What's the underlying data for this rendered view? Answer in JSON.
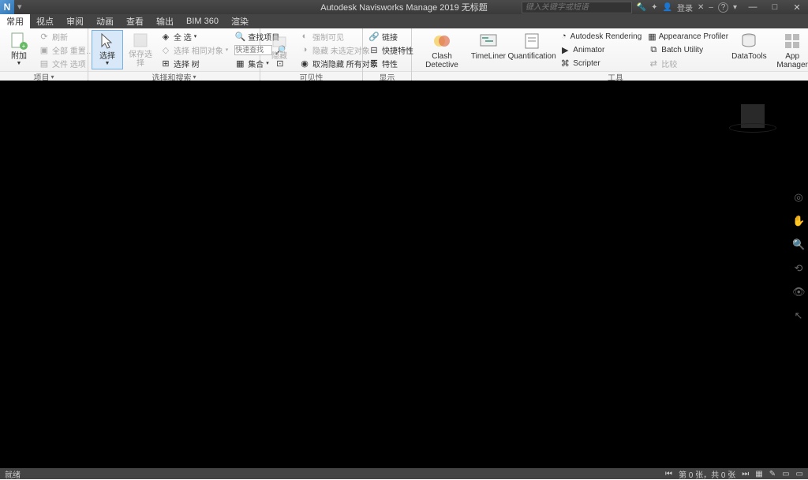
{
  "title": "Autodesk Navisworks Manage 2019    无标题",
  "search_placeholder": "键入关键字或短语",
  "login_label": "登录",
  "menus": [
    "常用",
    "视点",
    "审阅",
    "动画",
    "查看",
    "输出",
    "BIM 360",
    "渲染"
  ],
  "active_menu": 0,
  "panels": {
    "project": {
      "label": "项目",
      "append": "附加",
      "refresh": "刷新",
      "reset_all": "全部 重置…",
      "file_options": "文件 选项"
    },
    "select_search": {
      "label": "选择和搜索",
      "select": "选择",
      "save_sel": "保存选择",
      "select_all": "全 选",
      "sel_adjacent": "选择 相同对象",
      "sel_tree": "选择 树",
      "find_items": "查找项目",
      "quick_find": "快速查找",
      "sets": "集合"
    },
    "visibility": {
      "label": "可见性",
      "hide": "隐藏",
      "req_visible": "强制可见",
      "hide_unsel": "隐藏 未选定对象",
      "unhide_all": "取消隐藏 所有对象"
    },
    "display": {
      "label": "显示",
      "links": "链接",
      "quick_props": "快捷特性",
      "properties": "特性"
    },
    "tools": {
      "label": "工具",
      "clash": "Clash Detective",
      "timeliner": "TimeLiner",
      "quant": "Quantification",
      "rendering": "Autodesk Rendering",
      "animator": "Animator",
      "scripter": "Scripter",
      "appearance": "Appearance Profiler",
      "batch": "Batch Utility",
      "compare": "比较",
      "datatools": "DataTools",
      "appmgr": "App Manager"
    }
  },
  "status": {
    "left": "就绪",
    "sheets": "第 0 张，共 0 张"
  }
}
